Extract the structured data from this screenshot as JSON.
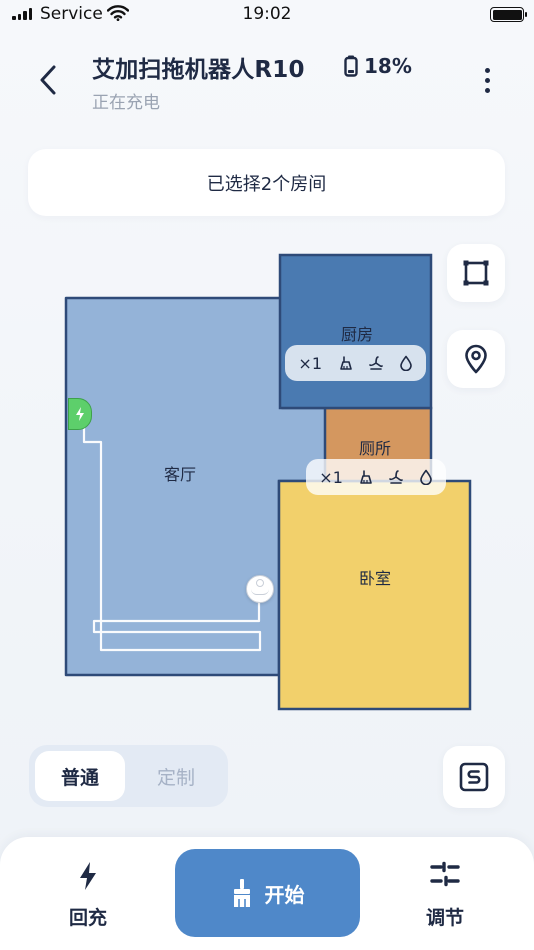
{
  "status_bar": {
    "carrier": "Service",
    "time": "19:02",
    "icons": [
      "signal-icon",
      "wifi-icon",
      "battery-icon"
    ]
  },
  "header": {
    "back_icon": "chevron-left-icon",
    "title": "艾加扫拖机器人R10",
    "status": "正在充电",
    "battery_percent": "18%",
    "battery_icon": "battery-icon",
    "more_icon": "more-vertical-icon"
  },
  "selection_banner": "已选择2个房间",
  "map": {
    "rooms": [
      {
        "name": "客厅",
        "color": "#94b3d8"
      },
      {
        "name": "厨房",
        "color": "#4a7ab1",
        "selected": true
      },
      {
        "name": "厕所",
        "color": "#d4975f",
        "selected": true
      },
      {
        "name": "卧室",
        "color": "#f2d06b"
      }
    ],
    "room_toolbar": {
      "count": "×1",
      "icons": [
        "vacuum-icon",
        "fan-suction-icon",
        "water-drop-icon"
      ]
    },
    "charging_dock_icon": "charging-dock-icon",
    "robot_icon": "robot-icon"
  },
  "tools": {
    "zone_icon": "zone-square-icon",
    "location_icon": "location-pin-icon",
    "sequence_icon": "s-mode-icon"
  },
  "mode": {
    "options": [
      "普通",
      "定制"
    ],
    "selected": "普通"
  },
  "bottom_bar": {
    "recharge_label": "回充",
    "recharge_icon": "lightning-icon",
    "start_label": "开始",
    "start_icon": "broom-icon",
    "adjust_label": "调节",
    "adjust_icon": "sliders-icon"
  },
  "colors": {
    "accent": "#4f88c9",
    "text": "#1f2a44",
    "muted": "#9aa3b2"
  }
}
